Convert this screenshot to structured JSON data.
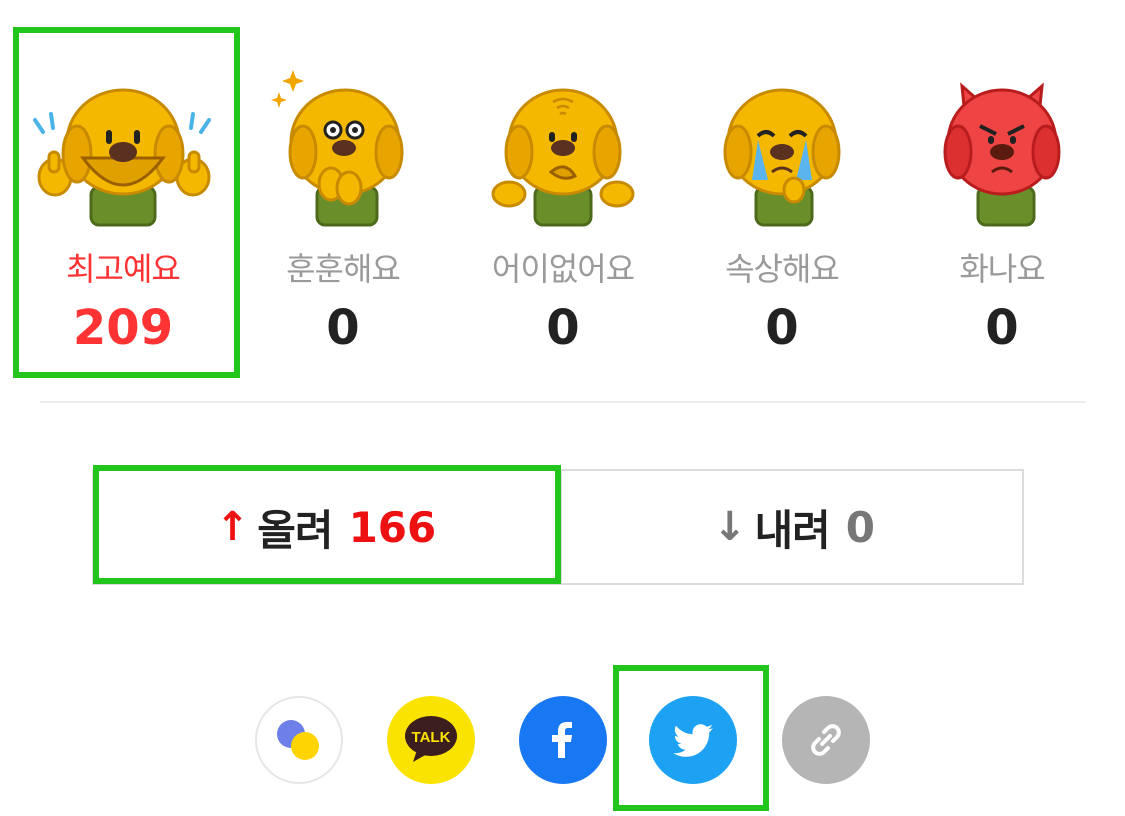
{
  "reactions": [
    {
      "label": "최고예요",
      "count": "209",
      "icon": "thumbs-up-dog-icon",
      "selected": true
    },
    {
      "label": "훈훈해요",
      "count": "0",
      "icon": "touched-dog-icon",
      "selected": false
    },
    {
      "label": "어이없어요",
      "count": "0",
      "icon": "shrug-dog-icon",
      "selected": false
    },
    {
      "label": "속상해요",
      "count": "0",
      "icon": "crying-dog-icon",
      "selected": false
    },
    {
      "label": "화나요",
      "count": "0",
      "icon": "angry-dog-icon",
      "selected": false
    }
  ],
  "vote": {
    "up_label": "올려",
    "up_count": "166",
    "down_label": "내려",
    "down_count": "0",
    "up_arrow": "↑",
    "down_arrow": "↓"
  },
  "share": {
    "buttons": [
      {
        "icon": "daum-share-icon",
        "bg": "#ffffff"
      },
      {
        "icon": "kakaotalk-icon",
        "text": "TALK",
        "bg": "#fbe300"
      },
      {
        "icon": "facebook-icon",
        "bg": "#1877f2"
      },
      {
        "icon": "twitter-icon",
        "bg": "#1da1f2"
      },
      {
        "icon": "link-icon",
        "bg": "#b5b5b5"
      }
    ]
  },
  "colors": {
    "accent": "#ff3333",
    "highlight": "#22c51c",
    "dog": "#f5b800",
    "shirt": "#6a8e2a",
    "angry": "#ef4444"
  }
}
